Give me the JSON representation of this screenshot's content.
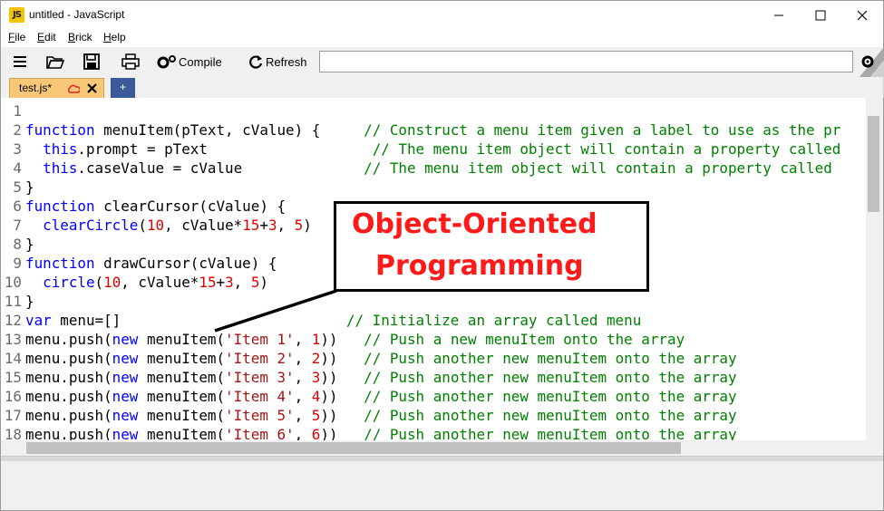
{
  "window": {
    "title": "untitled - JavaScript",
    "icon_text": "JS"
  },
  "menu": [
    "File",
    "Edit",
    "Brick",
    "Help"
  ],
  "menu_mnemonic": [
    "F",
    "E",
    "B",
    "H"
  ],
  "menu_rest": [
    "ile",
    "dit",
    "rick",
    "elp"
  ],
  "toolbar": {
    "compile_label": "Compile",
    "refresh_label": "Refresh",
    "command_value": ""
  },
  "tabs": {
    "active_label": "test.js*",
    "add_label": "+"
  },
  "code": [
    {
      "n": "1",
      "html": ""
    },
    {
      "n": "2",
      "html": "<span class=\"k\">function</span> menuItem(pText, cValue) {     <span class=\"c\">// Construct a menu item given a label to use as the pr</span>"
    },
    {
      "n": "3",
      "html": "  <span class=\"k\">this</span>.prompt = pText                   <span class=\"c\">// The menu item object will contain a property called</span>"
    },
    {
      "n": "4",
      "html": "  <span class=\"k\">this</span>.caseValue = cValue              <span class=\"c\">// The menu item object will contain a property called</span>"
    },
    {
      "n": "5",
      "html": "}"
    },
    {
      "n": "6",
      "html": "<span class=\"k\">function</span> clearCursor(cValue) {"
    },
    {
      "n": "7",
      "html": "  <span class=\"k\">clearCircle</span>(<span class=\"n\">10</span>, cValue*<span class=\"n\">15</span>+<span class=\"n\">3</span>, <span class=\"n\">5</span>)"
    },
    {
      "n": "8",
      "html": "}"
    },
    {
      "n": "9",
      "html": "<span class=\"k\">function</span> drawCursor(cValue) {"
    },
    {
      "n": "10",
      "html": "  <span class=\"k\">circle</span>(<span class=\"n\">10</span>, cValue*<span class=\"n\">15</span>+<span class=\"n\">3</span>, <span class=\"n\">5</span>)"
    },
    {
      "n": "11",
      "html": "}"
    },
    {
      "n": "12",
      "html": "<span class=\"k\">var</span> menu=[]                          <span class=\"c\">// Initialize an array called menu</span>"
    },
    {
      "n": "13",
      "html": "menu.push(<span class=\"k\">new</span> menuItem(<span class=\"s\">'Item 1'</span>, <span class=\"n\">1</span>))   <span class=\"c\">// Push a new menuItem onto the array</span>"
    },
    {
      "n": "14",
      "html": "menu.push(<span class=\"k\">new</span> menuItem(<span class=\"s\">'Item 2'</span>, <span class=\"n\">2</span>))   <span class=\"c\">// Push another new menuItem onto the array</span>"
    },
    {
      "n": "15",
      "html": "menu.push(<span class=\"k\">new</span> menuItem(<span class=\"s\">'Item 3'</span>, <span class=\"n\">3</span>))   <span class=\"c\">// Push another new menuItem onto the array</span>"
    },
    {
      "n": "16",
      "html": "menu.push(<span class=\"k\">new</span> menuItem(<span class=\"s\">'Item 4'</span>, <span class=\"n\">4</span>))   <span class=\"c\">// Push another new menuItem onto the array</span>"
    },
    {
      "n": "17",
      "html": "menu.push(<span class=\"k\">new</span> menuItem(<span class=\"s\">'Item 5'</span>, <span class=\"n\">5</span>))   <span class=\"c\">// Push another new menuItem onto the array</span>"
    },
    {
      "n": "18",
      "html": "menu.push(<span class=\"k\">new</span> menuItem(<span class=\"s\">'Item 6'</span>, <span class=\"n\">6</span>))   <span class=\"c\">// Push another new menuItem onto the array</span>"
    }
  ],
  "callout": {
    "line1": "Object-Oriented",
    "line2": "Programming"
  },
  "icons": [
    "hamburger-icon",
    "open-folder-icon",
    "save-icon",
    "print-icon",
    "gears-icon",
    "refresh-icon",
    "settings-gear-icon",
    "cloud-icon",
    "close-tab-icon",
    "minimize-icon",
    "maximize-icon",
    "close-icon"
  ],
  "colors": {
    "tab_active": "#f8c878",
    "tab_add": "#3a5a9a",
    "keyword": "#0000ff",
    "number": "#dd0000",
    "string": "#a31515",
    "comment": "#008000",
    "callout_text": "#ff1a1a"
  }
}
